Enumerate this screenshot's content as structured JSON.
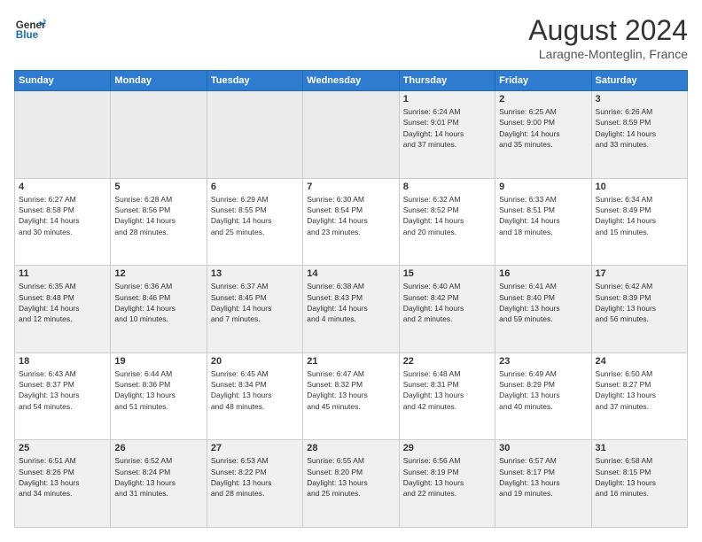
{
  "header": {
    "logo_line1": "General",
    "logo_line2": "Blue",
    "month": "August 2024",
    "location": "Laragne-Monteglin, France"
  },
  "weekdays": [
    "Sunday",
    "Monday",
    "Tuesday",
    "Wednesday",
    "Thursday",
    "Friday",
    "Saturday"
  ],
  "weeks": [
    [
      {
        "day": "",
        "info": ""
      },
      {
        "day": "",
        "info": ""
      },
      {
        "day": "",
        "info": ""
      },
      {
        "day": "",
        "info": ""
      },
      {
        "day": "1",
        "info": "Sunrise: 6:24 AM\nSunset: 9:01 PM\nDaylight: 14 hours\nand 37 minutes."
      },
      {
        "day": "2",
        "info": "Sunrise: 6:25 AM\nSunset: 9:00 PM\nDaylight: 14 hours\nand 35 minutes."
      },
      {
        "day": "3",
        "info": "Sunrise: 6:26 AM\nSunset: 8:59 PM\nDaylight: 14 hours\nand 33 minutes."
      }
    ],
    [
      {
        "day": "4",
        "info": "Sunrise: 6:27 AM\nSunset: 8:58 PM\nDaylight: 14 hours\nand 30 minutes."
      },
      {
        "day": "5",
        "info": "Sunrise: 6:28 AM\nSunset: 8:56 PM\nDaylight: 14 hours\nand 28 minutes."
      },
      {
        "day": "6",
        "info": "Sunrise: 6:29 AM\nSunset: 8:55 PM\nDaylight: 14 hours\nand 25 minutes."
      },
      {
        "day": "7",
        "info": "Sunrise: 6:30 AM\nSunset: 8:54 PM\nDaylight: 14 hours\nand 23 minutes."
      },
      {
        "day": "8",
        "info": "Sunrise: 6:32 AM\nSunset: 8:52 PM\nDaylight: 14 hours\nand 20 minutes."
      },
      {
        "day": "9",
        "info": "Sunrise: 6:33 AM\nSunset: 8:51 PM\nDaylight: 14 hours\nand 18 minutes."
      },
      {
        "day": "10",
        "info": "Sunrise: 6:34 AM\nSunset: 8:49 PM\nDaylight: 14 hours\nand 15 minutes."
      }
    ],
    [
      {
        "day": "11",
        "info": "Sunrise: 6:35 AM\nSunset: 8:48 PM\nDaylight: 14 hours\nand 12 minutes."
      },
      {
        "day": "12",
        "info": "Sunrise: 6:36 AM\nSunset: 8:46 PM\nDaylight: 14 hours\nand 10 minutes."
      },
      {
        "day": "13",
        "info": "Sunrise: 6:37 AM\nSunset: 8:45 PM\nDaylight: 14 hours\nand 7 minutes."
      },
      {
        "day": "14",
        "info": "Sunrise: 6:38 AM\nSunset: 8:43 PM\nDaylight: 14 hours\nand 4 minutes."
      },
      {
        "day": "15",
        "info": "Sunrise: 6:40 AM\nSunset: 8:42 PM\nDaylight: 14 hours\nand 2 minutes."
      },
      {
        "day": "16",
        "info": "Sunrise: 6:41 AM\nSunset: 8:40 PM\nDaylight: 13 hours\nand 59 minutes."
      },
      {
        "day": "17",
        "info": "Sunrise: 6:42 AM\nSunset: 8:39 PM\nDaylight: 13 hours\nand 56 minutes."
      }
    ],
    [
      {
        "day": "18",
        "info": "Sunrise: 6:43 AM\nSunset: 8:37 PM\nDaylight: 13 hours\nand 54 minutes."
      },
      {
        "day": "19",
        "info": "Sunrise: 6:44 AM\nSunset: 8:36 PM\nDaylight: 13 hours\nand 51 minutes."
      },
      {
        "day": "20",
        "info": "Sunrise: 6:45 AM\nSunset: 8:34 PM\nDaylight: 13 hours\nand 48 minutes."
      },
      {
        "day": "21",
        "info": "Sunrise: 6:47 AM\nSunset: 8:32 PM\nDaylight: 13 hours\nand 45 minutes."
      },
      {
        "day": "22",
        "info": "Sunrise: 6:48 AM\nSunset: 8:31 PM\nDaylight: 13 hours\nand 42 minutes."
      },
      {
        "day": "23",
        "info": "Sunrise: 6:49 AM\nSunset: 8:29 PM\nDaylight: 13 hours\nand 40 minutes."
      },
      {
        "day": "24",
        "info": "Sunrise: 6:50 AM\nSunset: 8:27 PM\nDaylight: 13 hours\nand 37 minutes."
      }
    ],
    [
      {
        "day": "25",
        "info": "Sunrise: 6:51 AM\nSunset: 8:26 PM\nDaylight: 13 hours\nand 34 minutes."
      },
      {
        "day": "26",
        "info": "Sunrise: 6:52 AM\nSunset: 8:24 PM\nDaylight: 13 hours\nand 31 minutes."
      },
      {
        "day": "27",
        "info": "Sunrise: 6:53 AM\nSunset: 8:22 PM\nDaylight: 13 hours\nand 28 minutes."
      },
      {
        "day": "28",
        "info": "Sunrise: 6:55 AM\nSunset: 8:20 PM\nDaylight: 13 hours\nand 25 minutes."
      },
      {
        "day": "29",
        "info": "Sunrise: 6:56 AM\nSunset: 8:19 PM\nDaylight: 13 hours\nand 22 minutes."
      },
      {
        "day": "30",
        "info": "Sunrise: 6:57 AM\nSunset: 8:17 PM\nDaylight: 13 hours\nand 19 minutes."
      },
      {
        "day": "31",
        "info": "Sunrise: 6:58 AM\nSunset: 8:15 PM\nDaylight: 13 hours\nand 16 minutes."
      }
    ]
  ]
}
